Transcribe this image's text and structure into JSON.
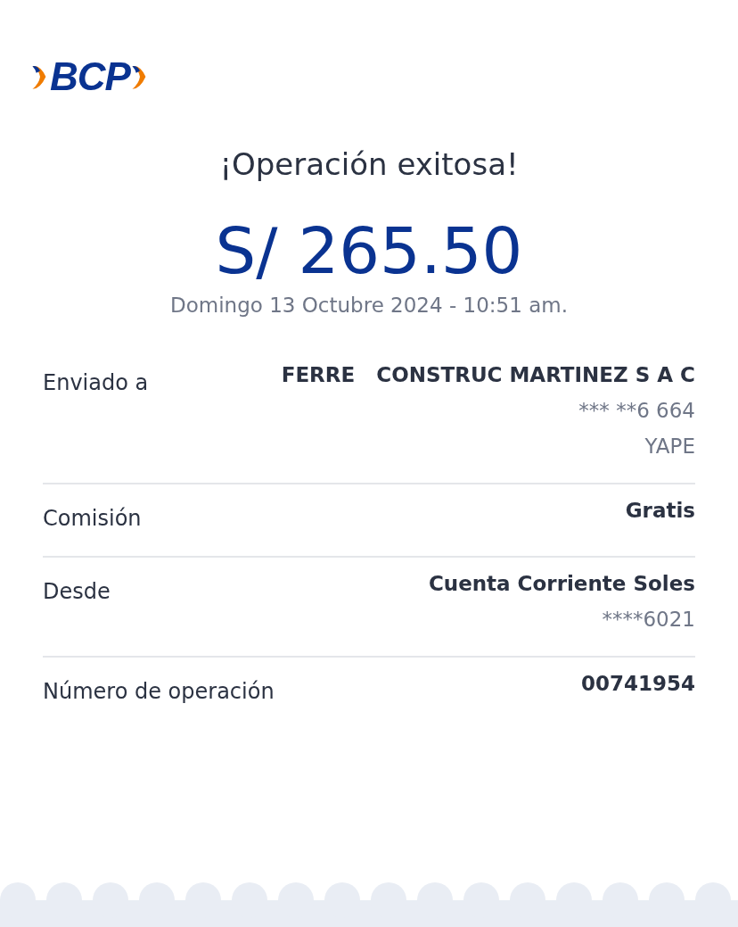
{
  "logo": {
    "text": "BCP"
  },
  "title": "¡Operación exitosa!",
  "amount": "S/ 265.50",
  "date": "Domingo 13 Octubre 2024 - 10:51 am.",
  "rows": [
    {
      "label": "Enviado a",
      "values": [
        {
          "kind": "primary",
          "text": "FERRE   CONSTRUC MARTINEZ S A C"
        },
        {
          "kind": "secondary",
          "text": "*** **6 664"
        },
        {
          "kind": "secondary",
          "text": "YAPE"
        }
      ]
    },
    {
      "label": "Comisión",
      "values": [
        {
          "kind": "primary",
          "text": "Gratis"
        }
      ]
    },
    {
      "label": "Desde",
      "values": [
        {
          "kind": "primary",
          "text": "Cuenta Corriente Soles"
        },
        {
          "kind": "secondary",
          "text": "****6021"
        }
      ]
    },
    {
      "label": "Número de operación",
      "values": [
        {
          "kind": "primary",
          "text": "00741954"
        }
      ]
    }
  ]
}
